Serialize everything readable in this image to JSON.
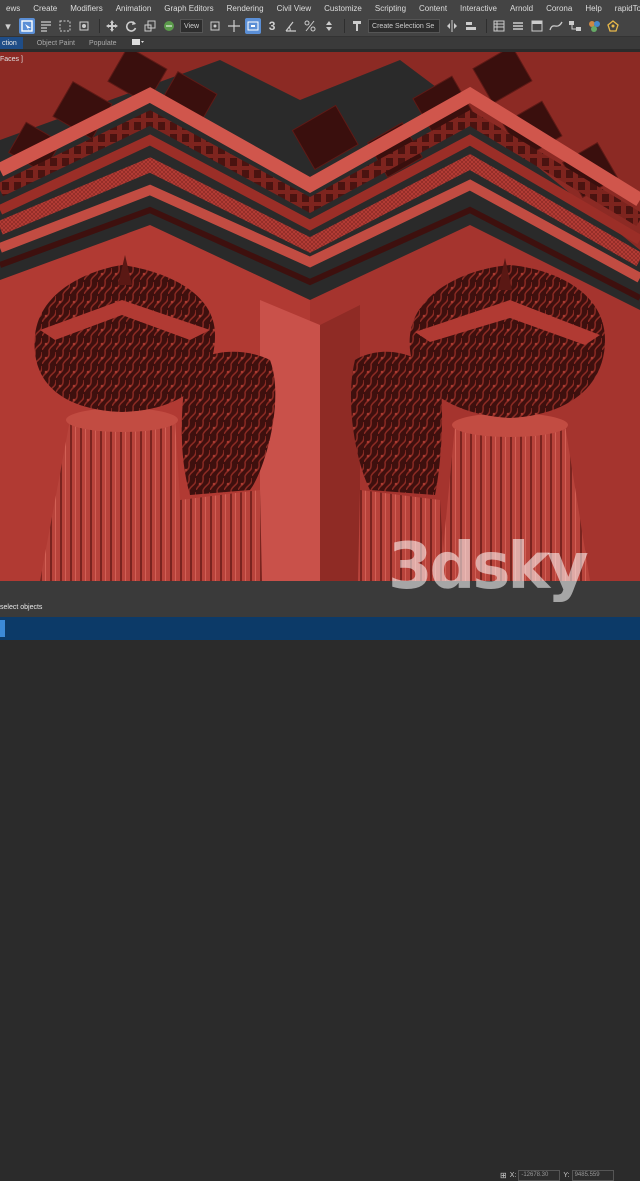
{
  "menu": [
    "ews",
    "Create",
    "Modifiers",
    "Animation",
    "Graph Editors",
    "Rendering",
    "Civil View",
    "Customize",
    "Scripting",
    "Content",
    "Interactive",
    "Arnold",
    "Corona",
    "Help",
    "rapidTools"
  ],
  "toolbar": {
    "view_dropdown": "View",
    "selection_set": "Create Selection Se",
    "snap_3d": "3"
  },
  "ribbon": {
    "tabs": [
      "ction",
      "Object Paint",
      "Populate"
    ]
  },
  "viewport": {
    "label": "Faces ]",
    "background": "#2a2a2a",
    "model_color": "#b53a33"
  },
  "status": {
    "prompt": "select objects",
    "x": "-12678.30",
    "y": "9485.559"
  },
  "watermark": "3dsky"
}
